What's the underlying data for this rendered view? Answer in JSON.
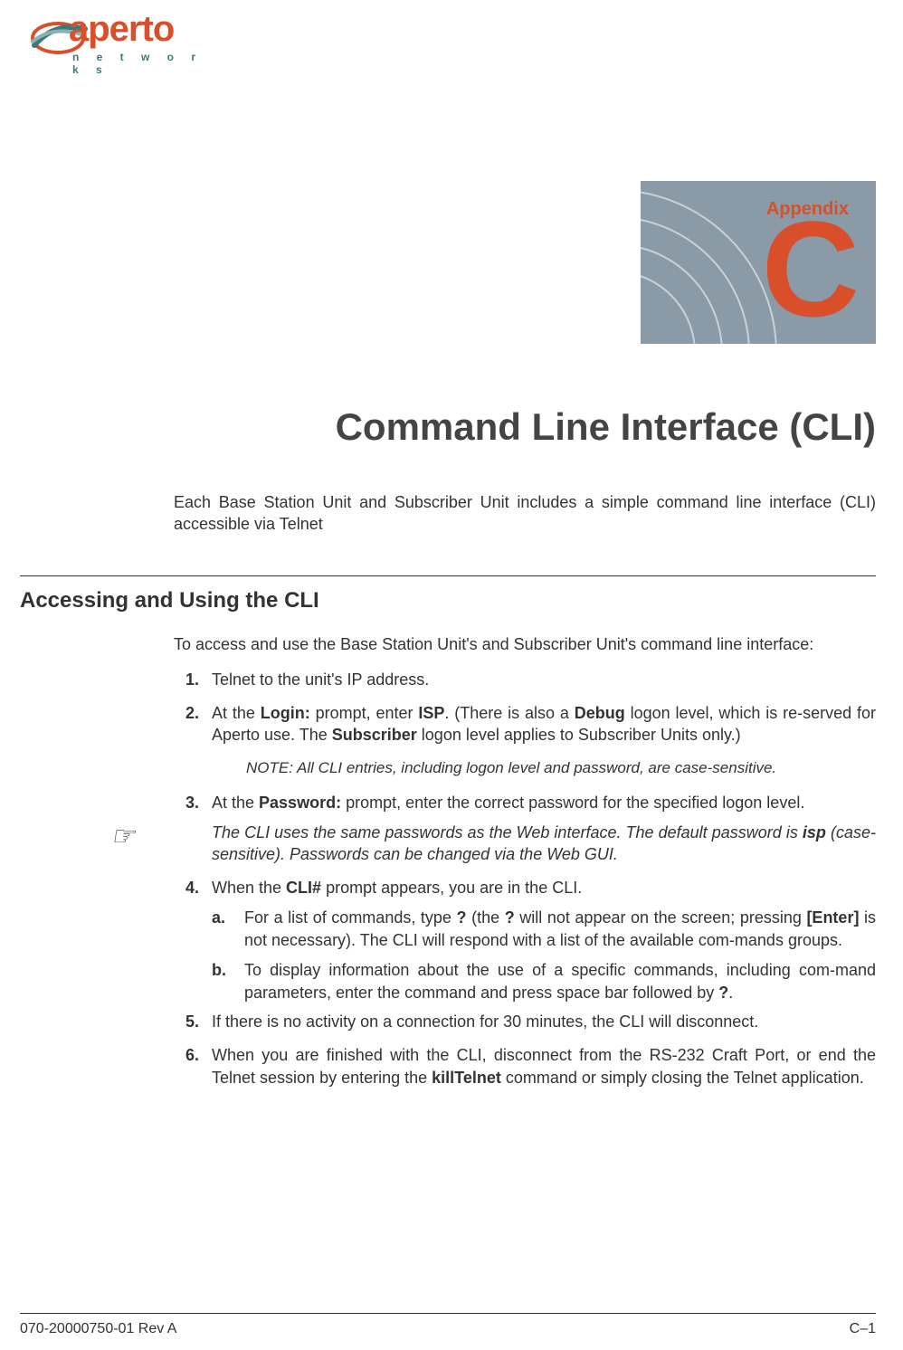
{
  "logo": {
    "text": "aperto",
    "subtext": "n e t w o r k s"
  },
  "appendix": {
    "label": "Appendix",
    "letter": "C"
  },
  "title": "Command Line Interface (CLI)",
  "intro": "Each Base Station Unit and Subscriber Unit includes a simple command line interface (CLI) accessible via Telnet",
  "section_heading": "Accessing and Using the CLI",
  "lead": "To access and use the Base Station Unit's and Subscriber Unit's command line interface:",
  "steps": {
    "s1": {
      "num": "1.",
      "text": "Telnet to the unit's IP address."
    },
    "s2": {
      "num": "2.",
      "pre": "At the ",
      "b1": "Login:",
      "mid1": " prompt, enter ",
      "b2": "ISP",
      "mid2": ". (There is also a ",
      "b3": "Debug",
      "mid3": " logon level, which is re-served for Aperto use. The ",
      "b4": "Subscriber",
      "post": " logon level applies to Subscriber Units only.)"
    },
    "note": {
      "label": "NOTE:  ",
      "text": "All CLI entries, including logon level and password, are case-sensitive."
    },
    "s3": {
      "num": "3.",
      "pre": "At the ",
      "b1": "Password:",
      "post": " prompt, enter the correct password for the specified logon level."
    },
    "tip": {
      "pre": "The CLI uses the same passwords as the Web interface. The default password is ",
      "b1": "isp",
      "post": " (case-sensitive). Passwords can be changed via the Web GUI."
    },
    "s4": {
      "num": "4.",
      "pre": "When the ",
      "b1": "CLI#",
      "post": " prompt appears, you are in the CLI."
    },
    "s4a": {
      "num": "a.",
      "pre": "For a list of commands, type ",
      "b1": "?",
      "mid1": " (the ",
      "b2": "?",
      "mid2": " will not appear on the screen; pressing ",
      "b3": "[Enter]",
      "post": " is not necessary). The CLI will respond with a list of the available com-mands groups."
    },
    "s4b": {
      "num": "b.",
      "pre": "To display information about the use of a specific commands, including com-mand parameters, enter the command and press space bar followed by ",
      "b1": "?",
      "post": "."
    },
    "s5": {
      "num": "5.",
      "text": "If there is no activity on a connection for 30 minutes, the CLI will disconnect."
    },
    "s6": {
      "num": "6.",
      "pre": "When you are finished with the CLI, disconnect from the RS-232 Craft Port, or end the Telnet session by entering the ",
      "b1": "killTelnet",
      "post": " command or simply closing the Telnet application."
    }
  },
  "footer": {
    "left": "070-20000750-01 Rev A",
    "right": "C–1"
  }
}
